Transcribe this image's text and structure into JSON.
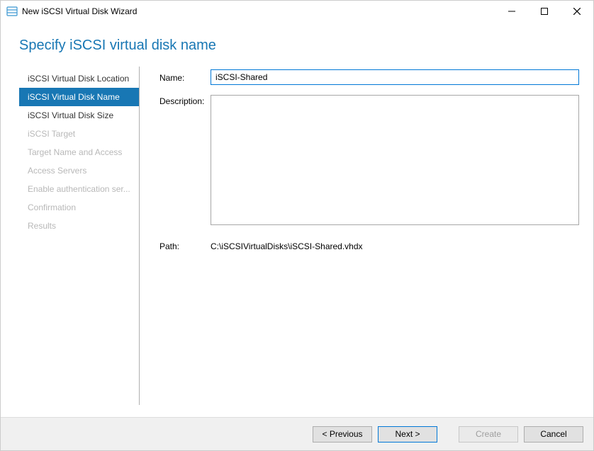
{
  "window": {
    "title": "New iSCSI Virtual Disk Wizard"
  },
  "heading": "Specify iSCSI virtual disk name",
  "sidebar": {
    "steps": [
      {
        "label": "iSCSI Virtual Disk Location",
        "state": "normal"
      },
      {
        "label": "iSCSI Virtual Disk Name",
        "state": "active"
      },
      {
        "label": "iSCSI Virtual Disk Size",
        "state": "normal"
      },
      {
        "label": "iSCSI Target",
        "state": "disabled"
      },
      {
        "label": "Target Name and Access",
        "state": "disabled"
      },
      {
        "label": "Access Servers",
        "state": "disabled"
      },
      {
        "label": "Enable authentication ser...",
        "state": "disabled"
      },
      {
        "label": "Confirmation",
        "state": "disabled"
      },
      {
        "label": "Results",
        "state": "disabled"
      }
    ]
  },
  "form": {
    "name_label": "Name:",
    "name_value": "iSCSI-Shared",
    "description_label": "Description:",
    "description_value": "",
    "path_label": "Path:",
    "path_value": "C:\\iSCSIVirtualDisks\\iSCSI-Shared.vhdx"
  },
  "footer": {
    "previous": "< Previous",
    "next": "Next >",
    "create": "Create",
    "cancel": "Cancel"
  }
}
